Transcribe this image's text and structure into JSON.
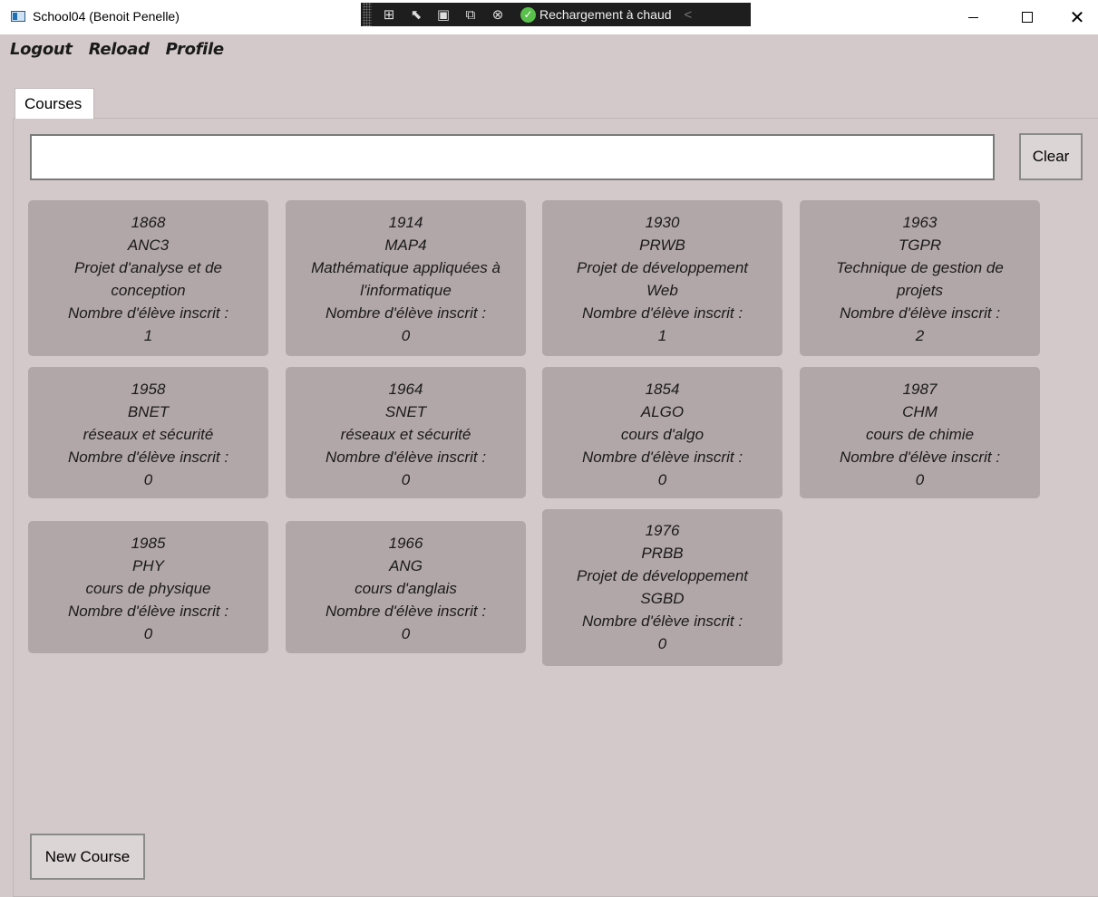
{
  "window": {
    "title": "School04 (Benoit Penelle)",
    "minimize": "–",
    "maximize": "☐",
    "close": "✕"
  },
  "debug_toolbar": {
    "hot_reload_label": "Rechargement à chaud",
    "icons": [
      "live-visual-tree-icon",
      "select-element-icon",
      "display-layout-adorners-icon",
      "track-focus-icon",
      "binding-failures-icon"
    ]
  },
  "menu": {
    "items": [
      "Logout",
      "Reload",
      "Profile"
    ]
  },
  "tabs": {
    "items": [
      "Courses"
    ]
  },
  "search": {
    "value": "",
    "placeholder": ""
  },
  "buttons": {
    "clear": "Clear",
    "new_course": "New Course"
  },
  "courses": [
    {
      "id": "1868",
      "code": "ANC3",
      "name_lines": [
        "Projet d'analyse et de",
        "conception"
      ],
      "enrolled_label": "Nombre d'élève inscrit :",
      "enrolled": "1"
    },
    {
      "id": "1914",
      "code": "MAP4",
      "name_lines": [
        "Mathématique appliquées à",
        "l'informatique"
      ],
      "enrolled_label": "Nombre d'élève inscrit :",
      "enrolled": "0"
    },
    {
      "id": "1930",
      "code": "PRWB",
      "name_lines": [
        "Projet de développement",
        "Web"
      ],
      "enrolled_label": "Nombre d'élève inscrit :",
      "enrolled": "1"
    },
    {
      "id": "1963",
      "code": "TGPR",
      "name_lines": [
        "Technique de gestion de",
        "projets"
      ],
      "enrolled_label": "Nombre d'élève inscrit :",
      "enrolled": "2"
    },
    {
      "id": "1958",
      "code": "BNET",
      "name_lines": [
        "réseaux et sécurité"
      ],
      "enrolled_label": "Nombre d'élève inscrit :",
      "enrolled": "0"
    },
    {
      "id": "1964",
      "code": "SNET",
      "name_lines": [
        "réseaux et sécurité"
      ],
      "enrolled_label": "Nombre d'élève inscrit :",
      "enrolled": "0"
    },
    {
      "id": "1854",
      "code": "ALGO",
      "name_lines": [
        "cours d'algo"
      ],
      "enrolled_label": "Nombre d'élève inscrit :",
      "enrolled": "0"
    },
    {
      "id": "1987",
      "code": "CHM",
      "name_lines": [
        "cours de chimie"
      ],
      "enrolled_label": "Nombre d'élève inscrit :",
      "enrolled": "0"
    },
    {
      "id": "1985",
      "code": "PHY",
      "name_lines": [
        "cours de physique"
      ],
      "enrolled_label": "Nombre d'élève inscrit :",
      "enrolled": "0"
    },
    {
      "id": "1966",
      "code": "ANG",
      "name_lines": [
        "cours d'anglais"
      ],
      "enrolled_label": "Nombre d'élève inscrit :",
      "enrolled": "0"
    },
    {
      "id": "1976",
      "code": "PRBB",
      "name_lines": [
        "Projet de développement",
        "SGBD"
      ],
      "enrolled_label": "Nombre d'élève inscrit :",
      "enrolled": "0"
    }
  ]
}
